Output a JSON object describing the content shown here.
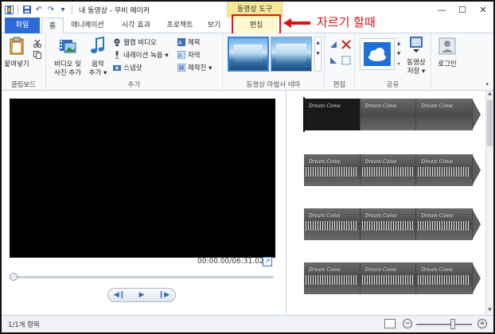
{
  "window": {
    "title": "내 동영상 - 무비 메이커",
    "context_tab_group": "동영상 도구",
    "minimize": "—",
    "maximize": "☐",
    "close": "✕"
  },
  "tabs": [
    {
      "label": "파일"
    },
    {
      "label": "홈"
    },
    {
      "label": "애니메이션"
    },
    {
      "label": "시각 효과"
    },
    {
      "label": "프로젝트"
    },
    {
      "label": "보기"
    },
    {
      "label": "편집"
    }
  ],
  "annotation": {
    "text": "자르기 할때",
    "color": "#e01010"
  },
  "ribbon": {
    "clipboard": {
      "group_label": "클립보드",
      "paste": "붙여넣기"
    },
    "add": {
      "group_label": "추가",
      "add_video_photo": [
        "비디오 및",
        "사진 추가"
      ],
      "add_music": [
        "음악",
        "추가 ▾"
      ],
      "webcam_video": "웹캠 비디오",
      "narration": "내레이션 녹음 ▾",
      "snapshot": "스냅샷",
      "title": "제목",
      "caption": "자막",
      "credits": "제작진 ▾"
    },
    "themes": {
      "group_label": "동영상 마법사 테마"
    },
    "edit": {
      "group_label": "편집"
    },
    "share": {
      "group_label": "공유",
      "save_movie": [
        "동영상",
        "저장 ▾"
      ],
      "sign_in": "로그인"
    }
  },
  "preview": {
    "timecode": "00:00.00/06:31.02",
    "progress": 0
  },
  "storyboard": {
    "clip_caption": "Dream Come",
    "clips": 4
  },
  "status": {
    "item_count": "1/1개 항목",
    "zoom_level": 0.65
  },
  "colors": {
    "accent": "#2b6ad8",
    "selection_border": "#4da0e0",
    "context_tab": "#f7e99a"
  }
}
